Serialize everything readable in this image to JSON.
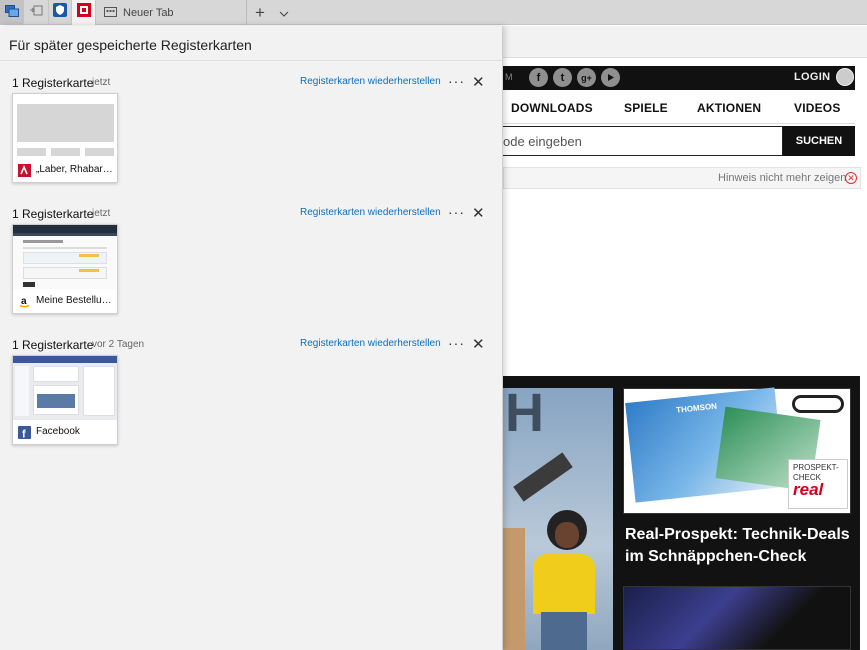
{
  "tabstrip": {
    "new_tab_label": "Neuer Tab"
  },
  "panel": {
    "title": "Für später gespeicherte Registerkarten",
    "groups": [
      {
        "count_label": "1 Registerkarte",
        "time": "jetzt",
        "restore_label": "Registerkarten wiederherstellen",
        "tab_title": "„Laber, Rhabar…",
        "favicon": "laber-rhabarber-favicon"
      },
      {
        "count_label": "1 Registerkarte",
        "time": "jetzt",
        "restore_label": "Registerkarten wiederherstellen",
        "tab_title": "Meine Bestellu…",
        "favicon": "amazon-favicon"
      },
      {
        "count_label": "1 Registerkarte",
        "time": "vor 2 Tagen",
        "restore_label": "Registerkarten wiederherstellen",
        "tab_title": "Facebook",
        "favicon": "facebook-favicon"
      }
    ]
  },
  "webpage": {
    "topbar_fragment": "M",
    "login_label": "LOGIN",
    "nav_items": [
      "DOWNLOADS",
      "SPIELE",
      "AKTIONEN",
      "VIDEOS"
    ],
    "search_value": "ode eingeben",
    "search_button": "SUCHEN",
    "hint_text": "Hinweis nicht mehr zeigen",
    "promo": {
      "prospekt_label": "PROSPEKT-CHECK",
      "real_brand": "real",
      "headline": "Real-Prospekt: Technik-Deals im Schnäppchen-Check",
      "catalog_brand": "THOMSON"
    }
  },
  "colors": {
    "accent_link": "#0a6fc2",
    "panel_bg": "#f2f2f2",
    "site_dark": "#111111",
    "real_red": "#d6001c"
  }
}
